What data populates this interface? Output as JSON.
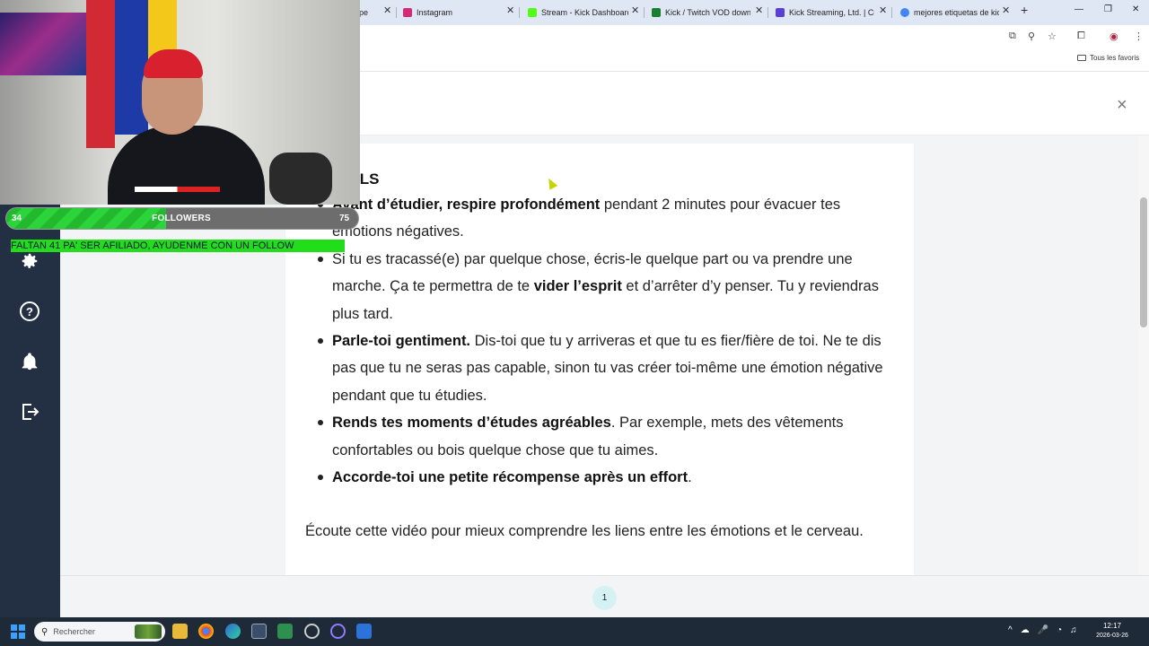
{
  "browser": {
    "tabs": [
      {
        "title": "pe",
        "favicon_color": "#e94c3d"
      },
      {
        "title": "Instagram",
        "favicon_color": "#d62976"
      },
      {
        "title": "Stream - Kick Dashboard",
        "favicon_color": "#53fc18"
      },
      {
        "title": "Kick / Twitch VOD downl",
        "favicon_color": "#1a7f2e"
      },
      {
        "title": "Kick Streaming, Ltd. | Co",
        "favicon_color": "#5b3fd1"
      },
      {
        "title": "mejores etiquetas de kic",
        "favicon_color": "#4285f4"
      }
    ],
    "new_tab": "+",
    "bookmark_folder": "Tous les favoris"
  },
  "page": {
    "close": "×",
    "section_heading": "ILS",
    "advice": [
      {
        "bold": "Avant d’étudier, respire profondément",
        "text": " pendant 2 minutes pour évacuer tes émotions négatives."
      },
      {
        "bold": "",
        "text": "Si tu es tracassé(e) par quelque chose, écris-le quelque part ou va prendre une marche. Ça te permettra de te ",
        "bold2": "vider l’esprit",
        "text2": " et d’arrêter d’y penser. Tu y reviendras plus tard."
      },
      {
        "bold": "Parle-toi gentiment.",
        "text": " Dis-toi que tu y arriveras et que tu es fier/fière de toi. Ne te dis pas que tu ne seras pas capable, sinon tu vas créer toi-même une émotion négative pendant que tu étudies."
      },
      {
        "bold": "Rends tes moments d’études agréables",
        "text": ". Par exemple, mets des vêtements confortables ou bois quelque chose que tu aimes."
      },
      {
        "bold": "Accorde-toi une petite récompense après un effort",
        "text": "."
      }
    ],
    "video_note": "Écoute cette vidéo pour mieux comprendre les liens entre les émotions et le cerveau.",
    "page_number": "1"
  },
  "sidebar": {
    "icons": [
      "gear-icon",
      "help-icon",
      "bell-icon",
      "logout-icon"
    ]
  },
  "stream_overlay": {
    "followers_label": "FOLLOWERS",
    "followers_current": "34",
    "followers_goal": "75",
    "followers_progress": 0.453,
    "ticker": "FALTAN 41 PA' SER AFILIADO, AYUDENME CON UN FOLLOW"
  },
  "taskbar": {
    "search_placeholder": "Rechercher",
    "time": "12:17",
    "date": "2026-03-26"
  },
  "colors": {
    "sidebar": "#233044",
    "follow_bar": "#2bd43a",
    "ticker_bg": "#22dd1a",
    "page_pill": "#d6f1f4"
  }
}
